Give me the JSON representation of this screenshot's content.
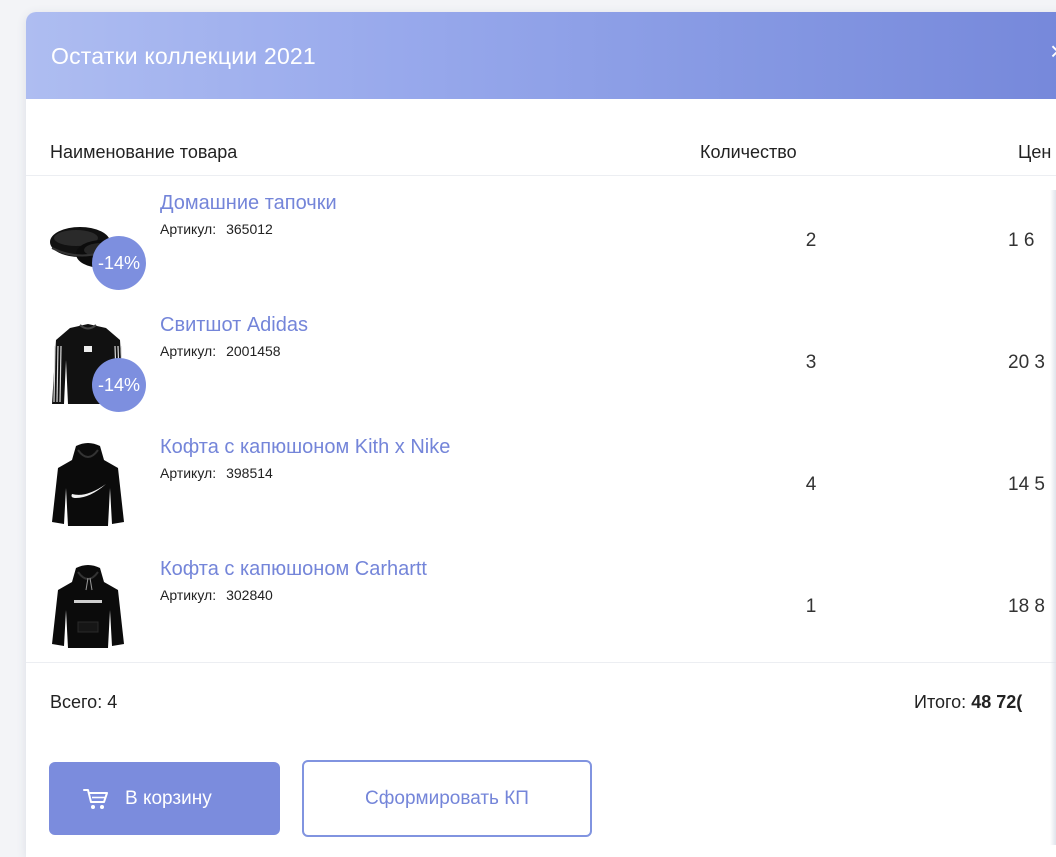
{
  "modal": {
    "title": "Остатки коллекции 2021",
    "close_glyph": "×"
  },
  "table": {
    "columns": {
      "name": "Наименование товара",
      "quantity": "Количество",
      "price": "Цен"
    },
    "sku_label": "Артикул:",
    "rows": [
      {
        "name": "Домашние тапочки",
        "sku": "365012",
        "quantity": "2",
        "price": "1 6",
        "discount": "-14%",
        "image": "slippers-image"
      },
      {
        "name": "Свитшот Adidas",
        "sku": "2001458",
        "quantity": "3",
        "price": "20 3",
        "discount": "-14%",
        "image": "sweatshirt-image"
      },
      {
        "name": "Кофта с капюшоном Kith x Nike",
        "sku": "398514",
        "quantity": "4",
        "price": "14 5",
        "discount": null,
        "image": "hoodie-nike-image"
      },
      {
        "name": "Кофта с капюшоном Carhartt",
        "sku": "302840",
        "quantity": "1",
        "price": "18 8",
        "discount": null,
        "image": "hoodie-carhartt-image"
      }
    ]
  },
  "summary": {
    "count_text": "Всего: 4",
    "total_label": "Итого:",
    "total_value": "48 72("
  },
  "actions": {
    "cart_label": "В корзину",
    "cart_icon": "cart-icon",
    "kp_label": "Сформировать КП"
  },
  "colors": {
    "accent": "#7b8cdd",
    "link": "#7485d9",
    "header_gradient_start": "#aebdf1",
    "header_gradient_end": "#7587da"
  }
}
